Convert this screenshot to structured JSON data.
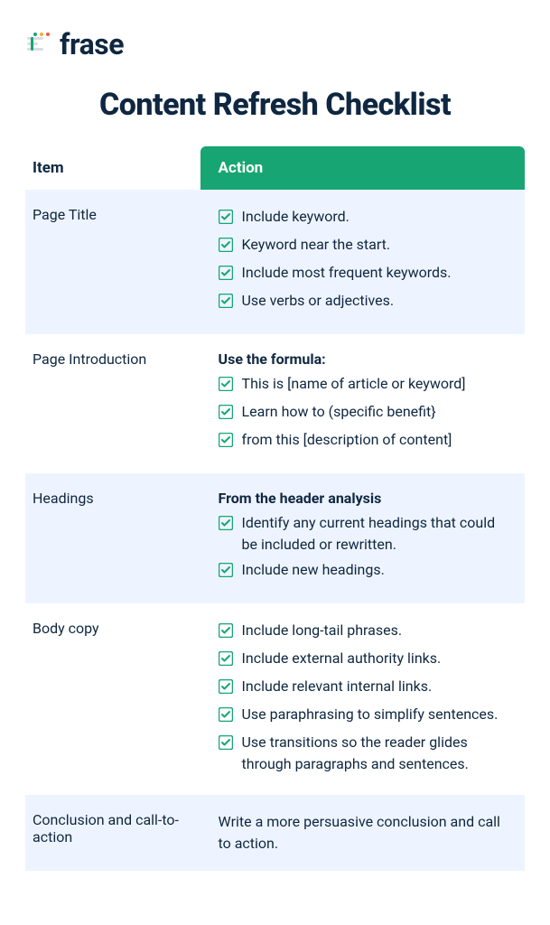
{
  "brand": "frase",
  "title": "Content Refresh Checklist",
  "headers": {
    "item": "Item",
    "action": "Action"
  },
  "rows": [
    {
      "item": "Page Title",
      "subhead": "",
      "checks": [
        "Include keyword.",
        "Keyword near the start.",
        "Include most frequent keywords.",
        "Use verbs or adjectives."
      ],
      "plain": ""
    },
    {
      "item": "Page Introduction",
      "subhead": "Use the formula:",
      "checks": [
        "This is [name of article or keyword]",
        "Learn how to (specific benefit}",
        "from this [description of content]"
      ],
      "plain": ""
    },
    {
      "item": "Headings",
      "subhead": "From the header analysis",
      "checks": [
        "Identify any current headings that could be included or rewritten.",
        "Include new headings."
      ],
      "plain": ""
    },
    {
      "item": "Body copy",
      "subhead": "",
      "checks": [
        "Include long-tail phrases.",
        "Include external authority links.",
        "Include relevant internal links.",
        "Use paraphrasing to simplify sentences.",
        "Use transitions so the reader glides through paragraphs and sentences."
      ],
      "plain": ""
    },
    {
      "item": "Conclusion and call-to-action",
      "subhead": "",
      "checks": [],
      "plain": "Write a more persuasive conclusion and call to action."
    }
  ]
}
